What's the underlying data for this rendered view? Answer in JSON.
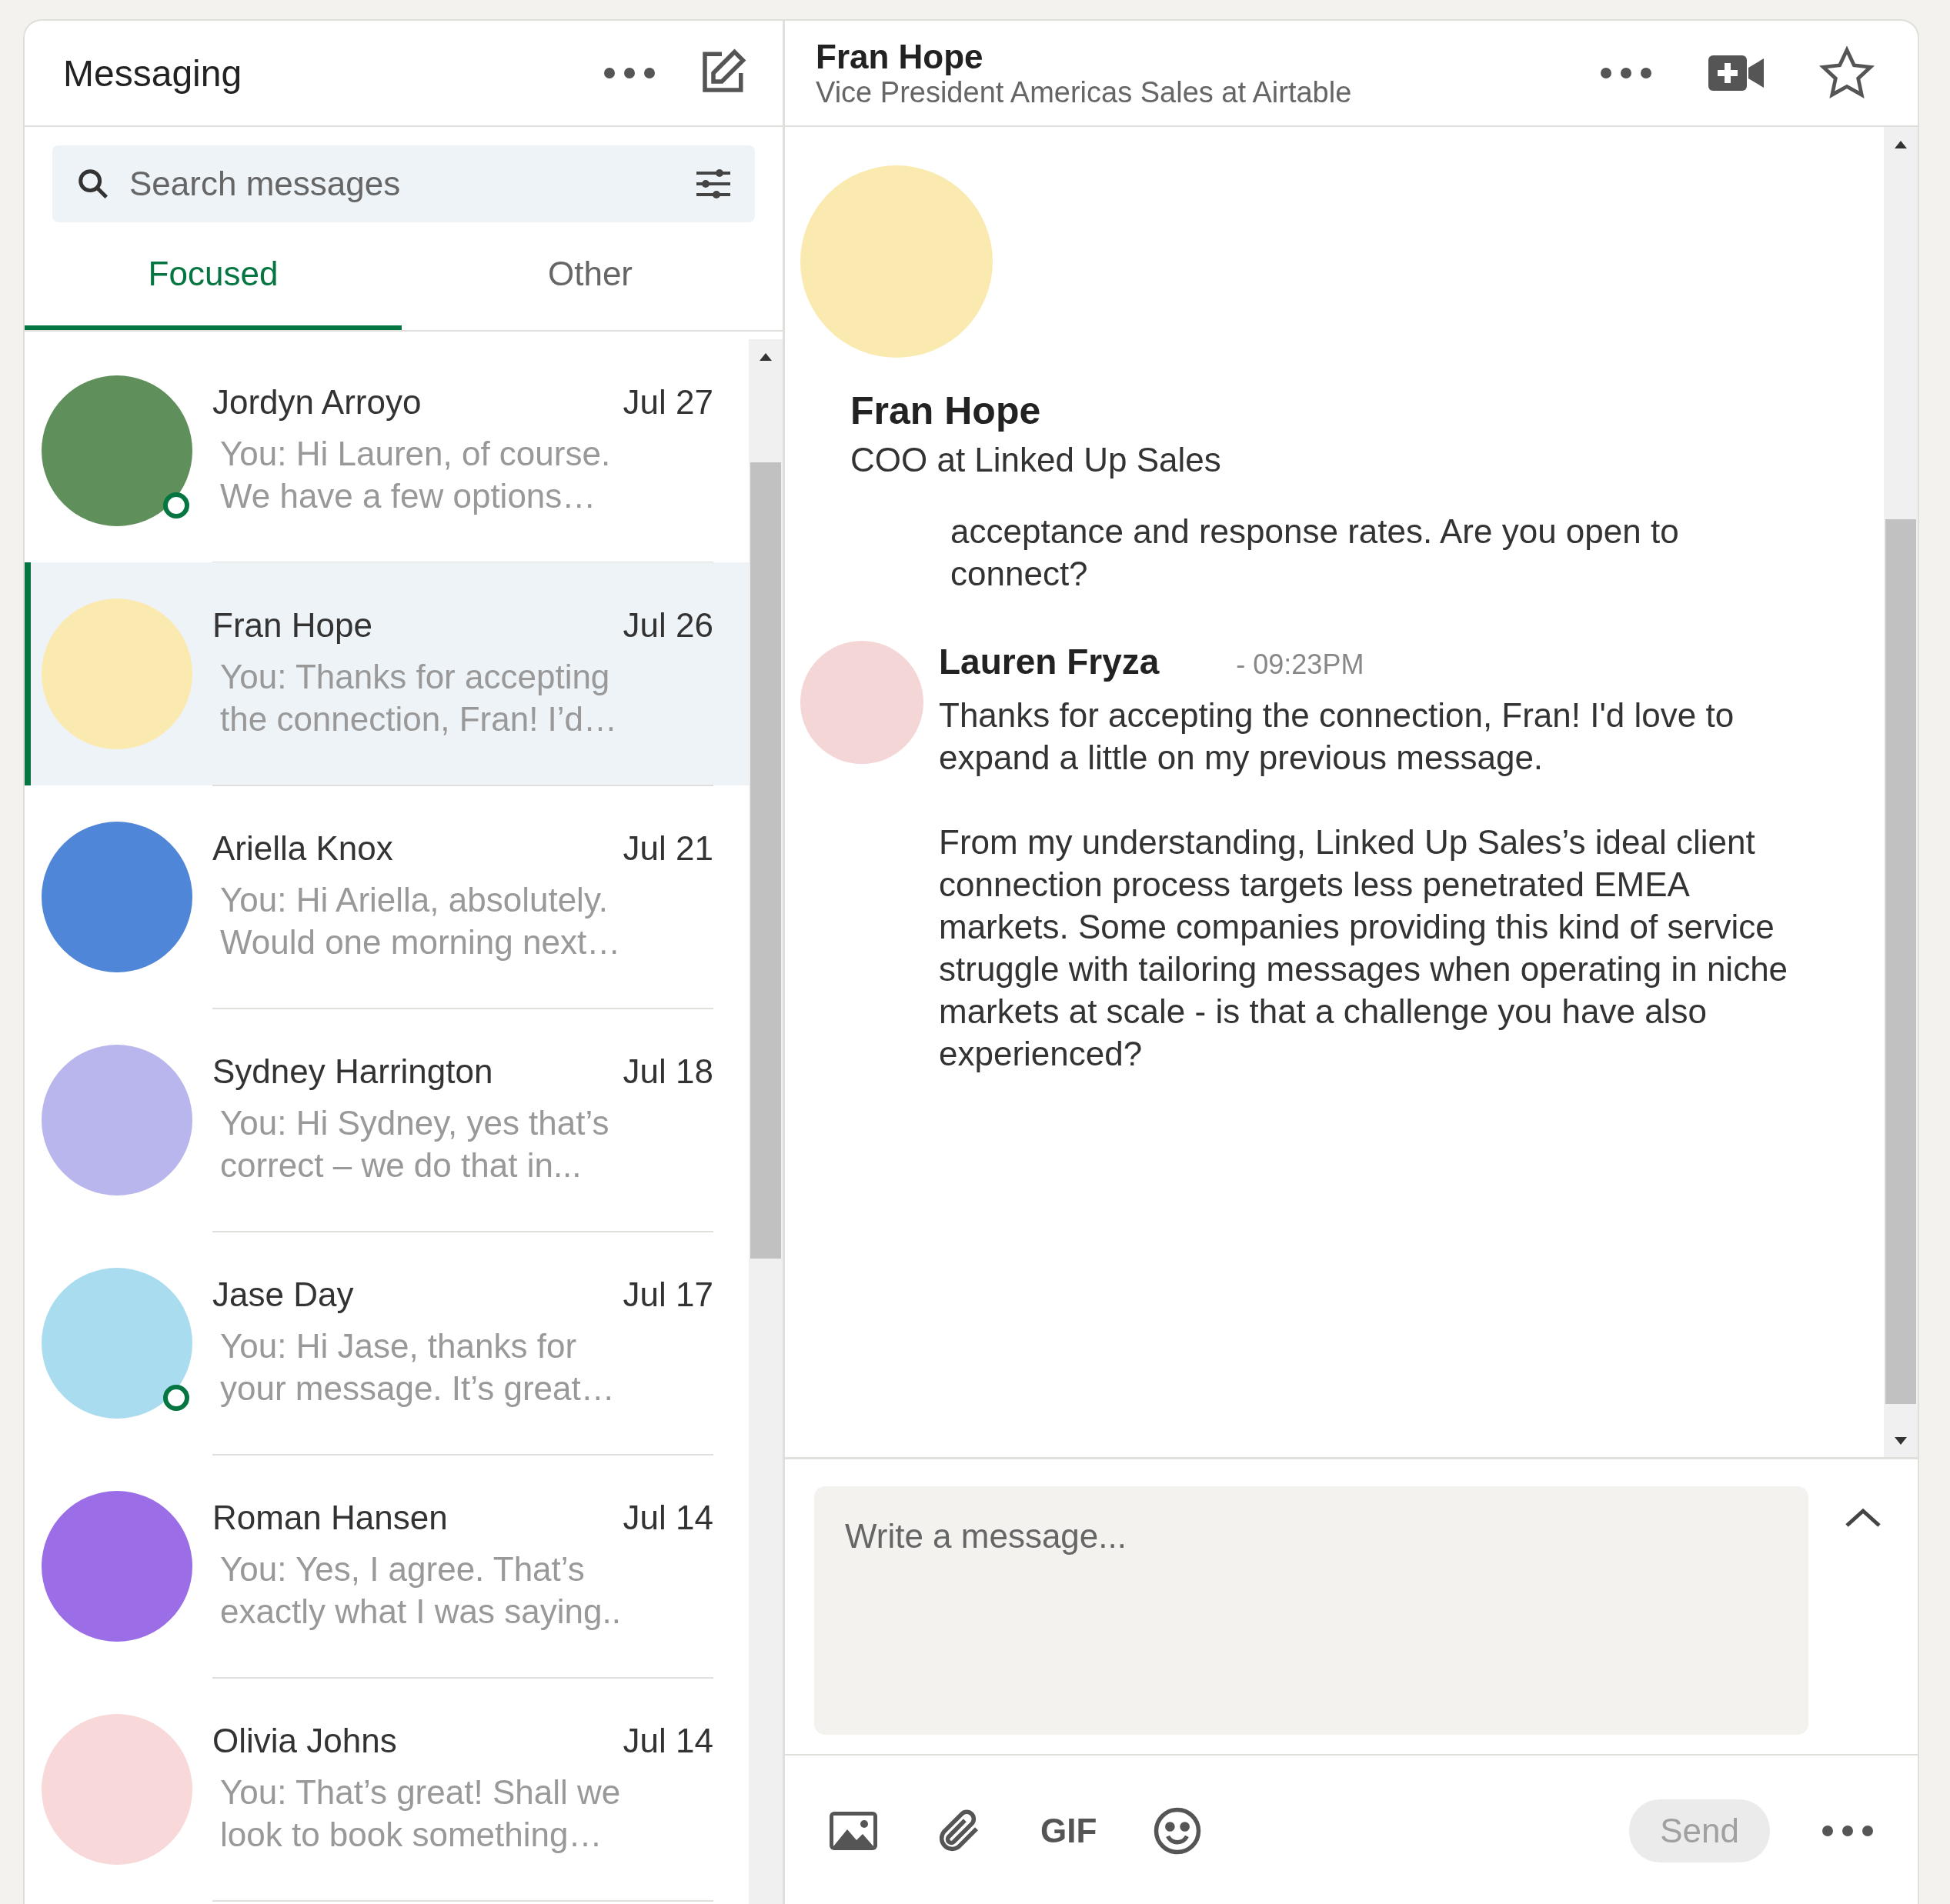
{
  "sidebar": {
    "title": "Messaging",
    "search": {
      "placeholder": "Search messages"
    },
    "tabs": [
      {
        "label": "Focused",
        "selected": true
      },
      {
        "label": "Other",
        "selected": false
      }
    ],
    "conversations": [
      {
        "name": "Jordyn Arroyo",
        "date": "Jul 27",
        "preview": "You: Hi Lauren, of course. We have a few options…",
        "selected": false,
        "online": true,
        "color": "#5f8f5a"
      },
      {
        "name": "Fran Hope",
        "date": "Jul 26",
        "preview": "You: Thanks for accepting the connection, Fran! I’d…",
        "selected": true,
        "online": false,
        "color": "#fbeab0"
      },
      {
        "name": "Ariella Knox",
        "date": "Jul 21",
        "preview": "You: Hi Ariella, absolutely. Would one morning next…",
        "selected": false,
        "online": false,
        "color": "#4f86d8"
      },
      {
        "name": "Sydney Harrington",
        "date": "Jul 18",
        "preview": "You: Hi Sydney, yes that’s correct – we do that in...",
        "selected": false,
        "online": false,
        "color": "#b9b6ee"
      },
      {
        "name": "Jase Day",
        "date": "Jul 17",
        "preview": "You: Hi Jase, thanks for your message. It’s great…",
        "selected": false,
        "online": true,
        "color": "#a9dcef"
      },
      {
        "name": "Roman Hansen",
        "date": "Jul 14",
        "preview": "You: Yes, I agree. That’s exactly what I was saying..",
        "selected": false,
        "online": false,
        "color": "#9b6ee8"
      },
      {
        "name": "Olivia Johns",
        "date": "Jul 14",
        "preview": "You: That’s great! Shall we look to book something…",
        "selected": false,
        "online": false,
        "color": "#f8d8d8"
      }
    ]
  },
  "conversation": {
    "header": {
      "name": "Fran Hope",
      "subtitle": "Vice President Americas Sales at Airtable"
    },
    "profile": {
      "name": "Fran Hope",
      "headline": "COO at Linked Up Sales"
    },
    "messages": [
      {
        "kind": "continuation",
        "paragraphs": [
          "acceptance and response rates. Are you open to connect?"
        ]
      },
      {
        "kind": "message",
        "sender": "Lauren Fryza",
        "time": "- 09:23PM",
        "paragraphs": [
          "Thanks for accepting the connection, Fran! I'd love to expand a little on my previous message.",
          "From my understanding, Linked Up Sales’s ideal client connection process targets less penetrated EMEA markets. Some companies providing this kind of service struggle with tailoring messages when operating in niche markets at scale - is that a challenge you have also experienced?"
        ]
      }
    ],
    "composer": {
      "placeholder": "Write a message...",
      "send": {
        "label": "Send",
        "disabled": true
      },
      "gif": "GIF"
    }
  }
}
